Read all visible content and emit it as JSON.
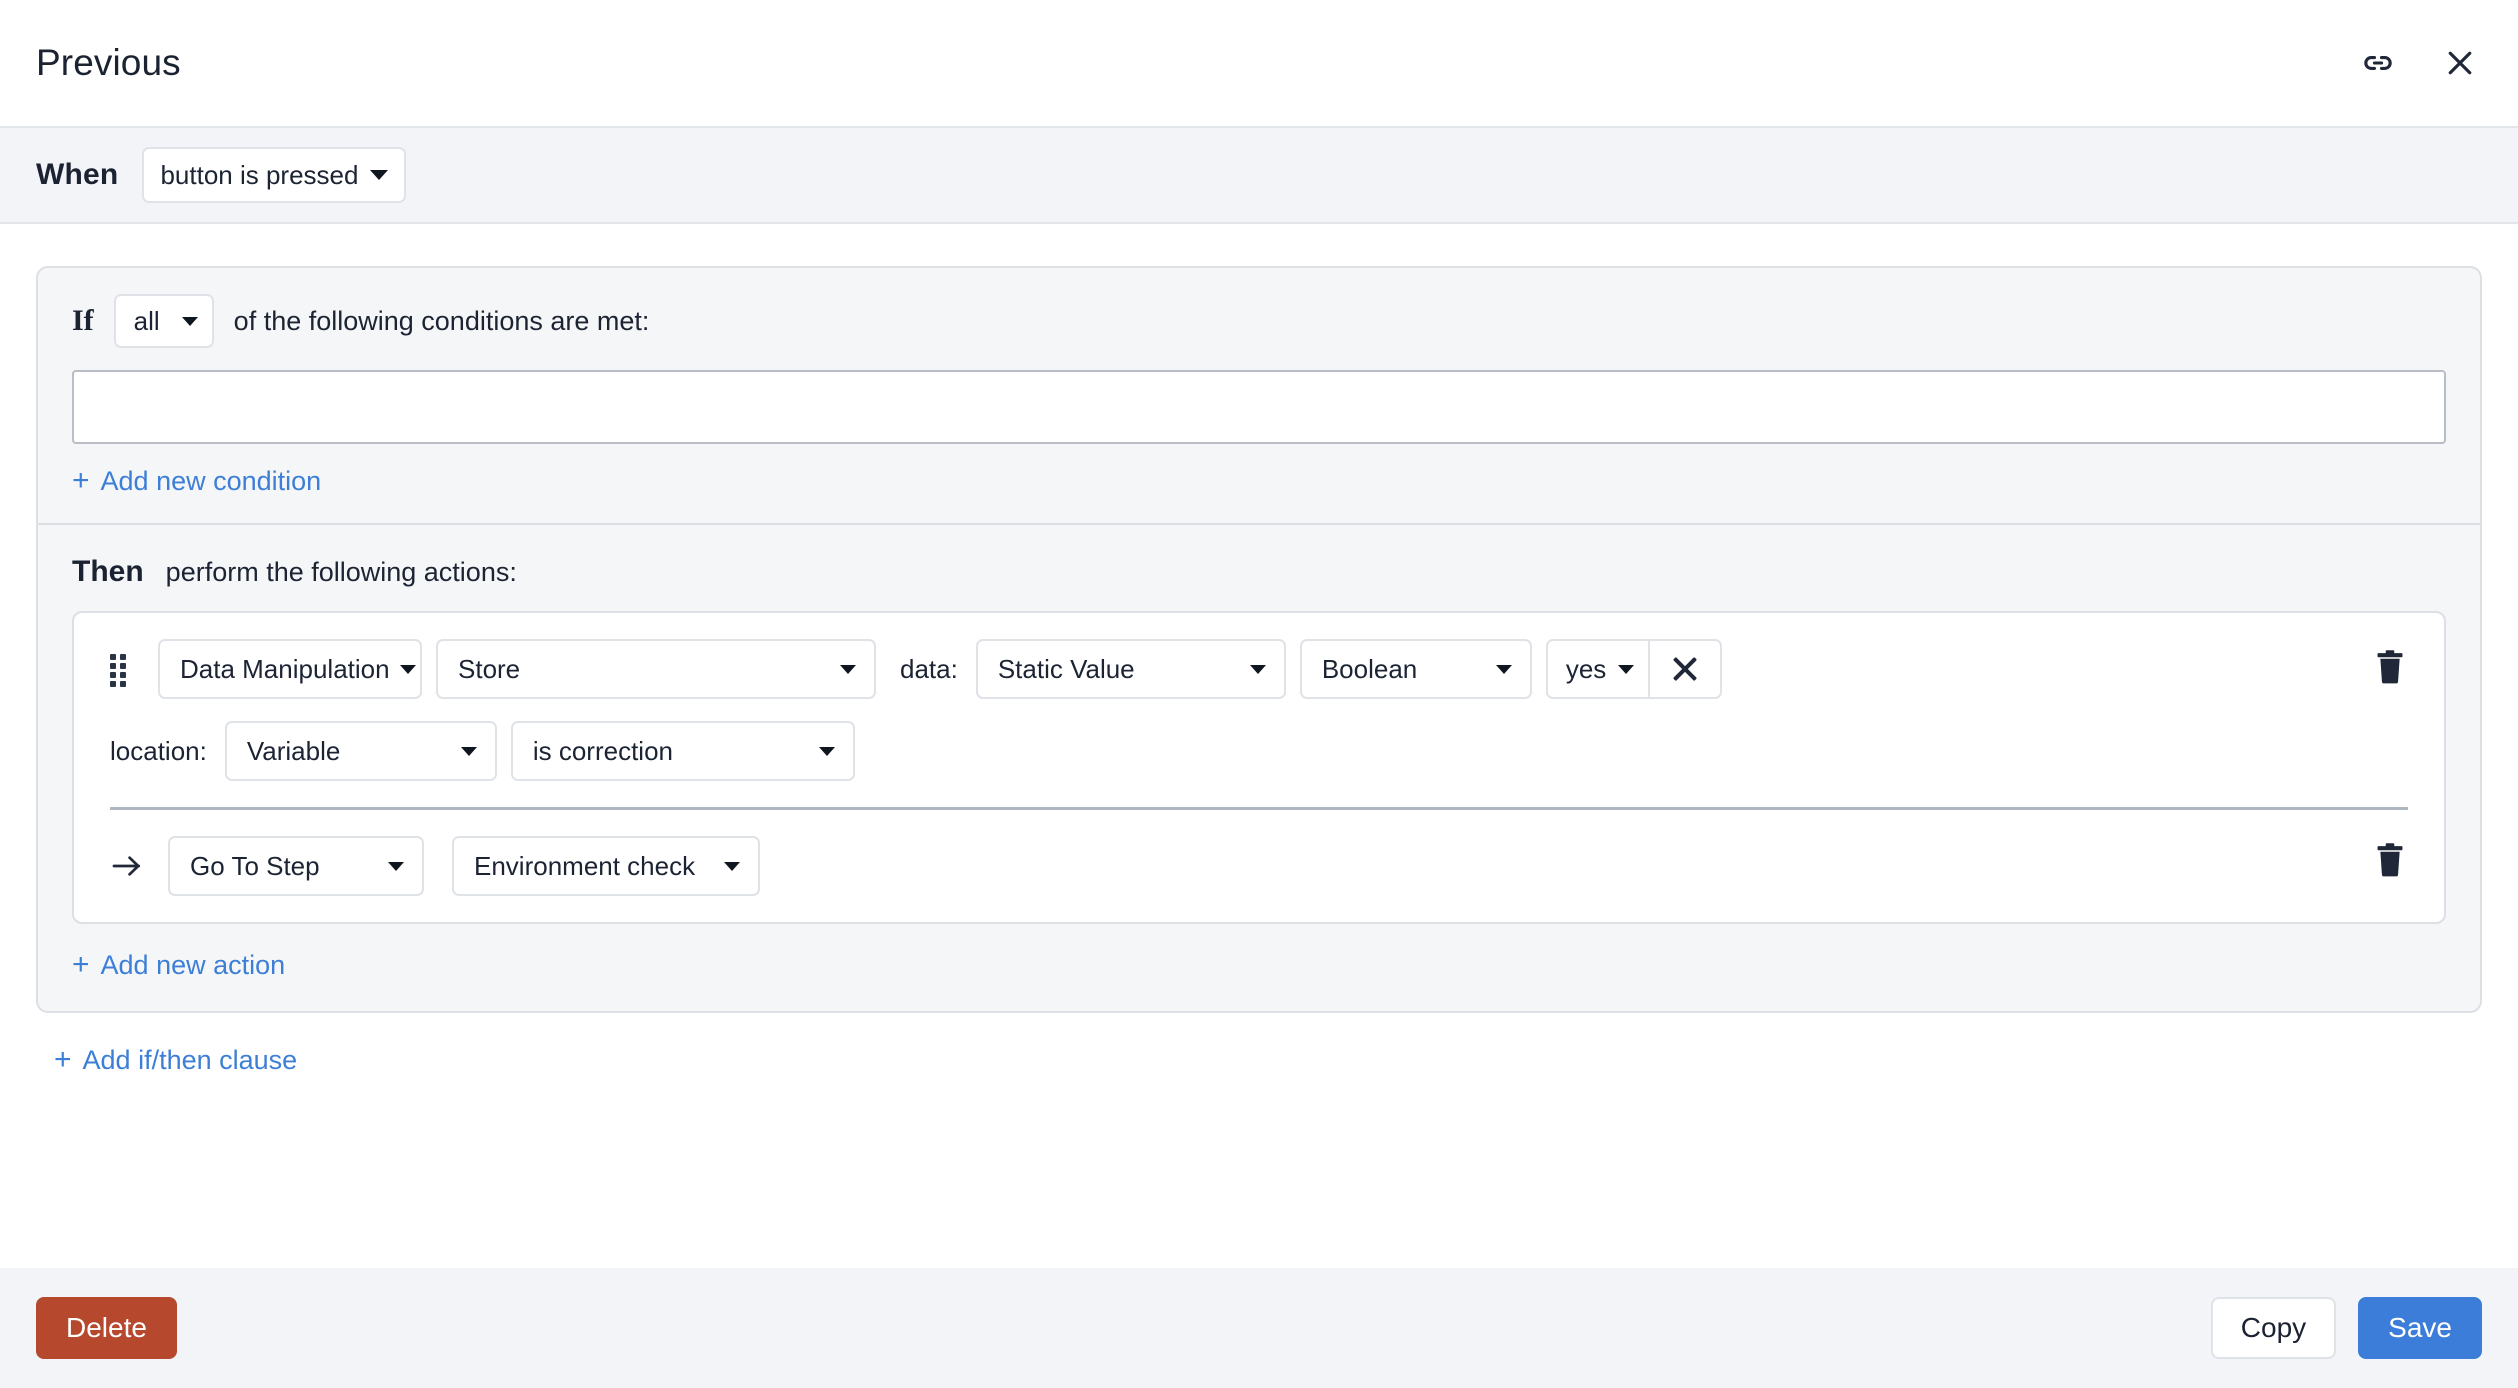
{
  "header": {
    "title": "Previous",
    "link_icon": "link-icon",
    "close_icon": "close-icon"
  },
  "when": {
    "label": "When",
    "trigger": "button is pressed"
  },
  "clause": {
    "if": {
      "label": "If",
      "quantifier": "all",
      "text": "of the following conditions are met:",
      "condition_value": "",
      "add_condition_label": "Add new condition",
      "plus": "+"
    },
    "then": {
      "label": "Then",
      "text": "perform the following actions:",
      "add_action_label": "Add new action",
      "plus": "+",
      "actions": [
        {
          "handle_icon": "drag-handle-icon",
          "category": "Data Manipulation",
          "operation": "Store",
          "data_label": "data:",
          "data_source": "Static Value",
          "data_type": "Boolean",
          "data_value": "yes",
          "clear_icon": "close-icon",
          "location_label": "location:",
          "location_type": "Variable",
          "location_name": "is correction",
          "delete_icon": "trash-icon"
        },
        {
          "lead_icon": "arrow-right-icon",
          "category": "Go To Step",
          "target": "Environment check",
          "delete_icon": "trash-icon"
        }
      ]
    },
    "add_clause_label": "Add if/then clause",
    "add_clause_plus": "+"
  },
  "footer": {
    "delete_label": "Delete",
    "copy_label": "Copy",
    "save_label": "Save"
  },
  "colors": {
    "accent_blue": "#3b7dd8",
    "link_blue": "#3d7fd6",
    "danger_red": "#b5482d",
    "panel_gray": "#f2f4f7",
    "border_gray": "#dcdfe4",
    "text_dark": "#1b2231"
  }
}
